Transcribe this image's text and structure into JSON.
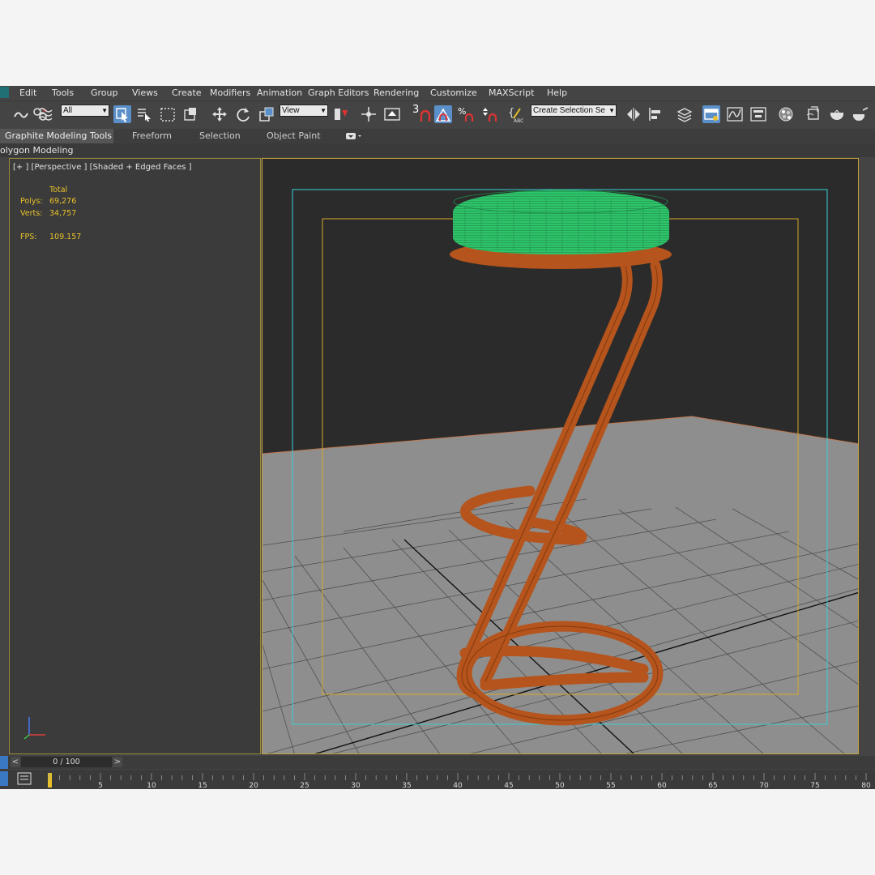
{
  "menu": {
    "items": [
      "Edit",
      "Tools",
      "Group",
      "Views",
      "Create",
      "Modifiers",
      "Animation",
      "Graph Editors",
      "Rendering",
      "Customize",
      "MAXScript",
      "Help"
    ]
  },
  "toolbar": {
    "selection_filter": "All",
    "reference_coord": "View",
    "snap_value": "3",
    "named_selection_placeholder": "Create Selection Se",
    "icons": [
      "link-icon",
      "unlink-icon",
      "bind-spacewarp-icon",
      "select-object-icon",
      "select-by-name-icon",
      "rect-region-icon",
      "window-crossing-icon",
      "move-icon",
      "rotate-icon",
      "scale-icon",
      "select-manipulate-icon",
      "pivot-icon",
      "snap-toggle-icon",
      "angle-snap-icon",
      "percent-snap-icon",
      "spinner-snap-icon",
      "edit-named-sets-icon",
      "mirror-icon",
      "align-icon",
      "layer-manager-icon",
      "ribbon-toggle-icon",
      "curve-editor-icon",
      "schematic-view-icon",
      "material-editor-icon",
      "render-setup-icon",
      "rendered-frame-icon",
      "render-icon"
    ]
  },
  "ribbon": {
    "tabs": [
      "Graphite Modeling Tools",
      "Freeform",
      "Selection",
      "Object Paint"
    ],
    "active_tab": "Graphite Modeling Tools",
    "sub_label": "olygon Modeling"
  },
  "viewport": {
    "label": "[+ ] [Perspective ] [Shaded + Edged Faces ]",
    "stats": {
      "header": "Total",
      "polys_label": "Polys:",
      "polys_value": "69,276",
      "verts_label": "Verts:",
      "verts_value": "34,757",
      "fps_label": "FPS:",
      "fps_value": "109.157"
    },
    "colors": {
      "seat": "#2ec46a",
      "frame": "#b5541c",
      "safe_frame": "#3ad0d8",
      "action_safe": "#d8a828",
      "floor": "#8e8e8e",
      "background": "#2b2b2b"
    }
  },
  "timeline": {
    "frame_display": "0 / 100",
    "prev_label": "<",
    "next_label": ">",
    "ticks": [
      5,
      10,
      15,
      20,
      25,
      30,
      35,
      40,
      45,
      50,
      55,
      60,
      65,
      70,
      75,
      80
    ]
  }
}
